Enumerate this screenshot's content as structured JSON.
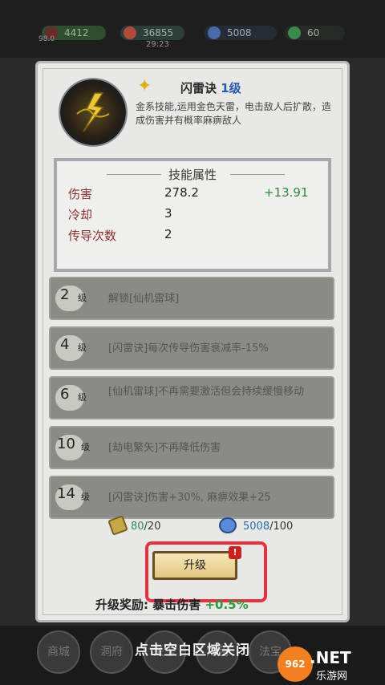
{
  "topbar": {
    "res1": "4412",
    "res2": "36855",
    "res3": "5008",
    "res4": "60",
    "level": "98.0",
    "timer": "29:23"
  },
  "skill": {
    "name": "闪雷诀",
    "level": "1级",
    "description": "金系技能,运用金色天雷，电击敌人后扩散，造成伤害并有概率麻痹敌人"
  },
  "attributes": {
    "title": "技能属性",
    "rows": [
      {
        "name": "伤害",
        "value": "278.2",
        "increase": "+13.91"
      },
      {
        "name": "冷却",
        "value": "3",
        "increase": ""
      },
      {
        "name": "传导次数",
        "value": "2",
        "increase": ""
      }
    ]
  },
  "levels": [
    {
      "num": "2",
      "unit": "级",
      "text": "解锁[仙机雷球]"
    },
    {
      "num": "4",
      "unit": "级",
      "text": "[闪雷诀]每次传导伤害衰减率-15%"
    },
    {
      "num": "6",
      "unit": "级",
      "text": "[仙机雷球]不再需要激活但会持续缓慢移动"
    },
    {
      "num": "10",
      "unit": "级",
      "text": "[劫电繁矢]不再降低伤害"
    },
    {
      "num": "14",
      "unit": "级",
      "text": "[闪雷诀]伤害+30%, 麻痹效果+25"
    }
  ],
  "costs": {
    "scroll_have": "80",
    "scroll_need": "/20",
    "gem_have": "5008",
    "gem_need": "/100"
  },
  "upgrade": {
    "label": "升级",
    "badge": "!"
  },
  "reward": {
    "label": "升级奖励: 暴击伤害",
    "value": "+0.5%"
  },
  "nav": [
    "商城",
    "洞府",
    "关卡",
    "角色",
    "法宝"
  ],
  "close_hint": "点击空白区域关闭",
  "watermark": {
    "circle": "962",
    "text": ".NET",
    "sub": "乐游网"
  }
}
